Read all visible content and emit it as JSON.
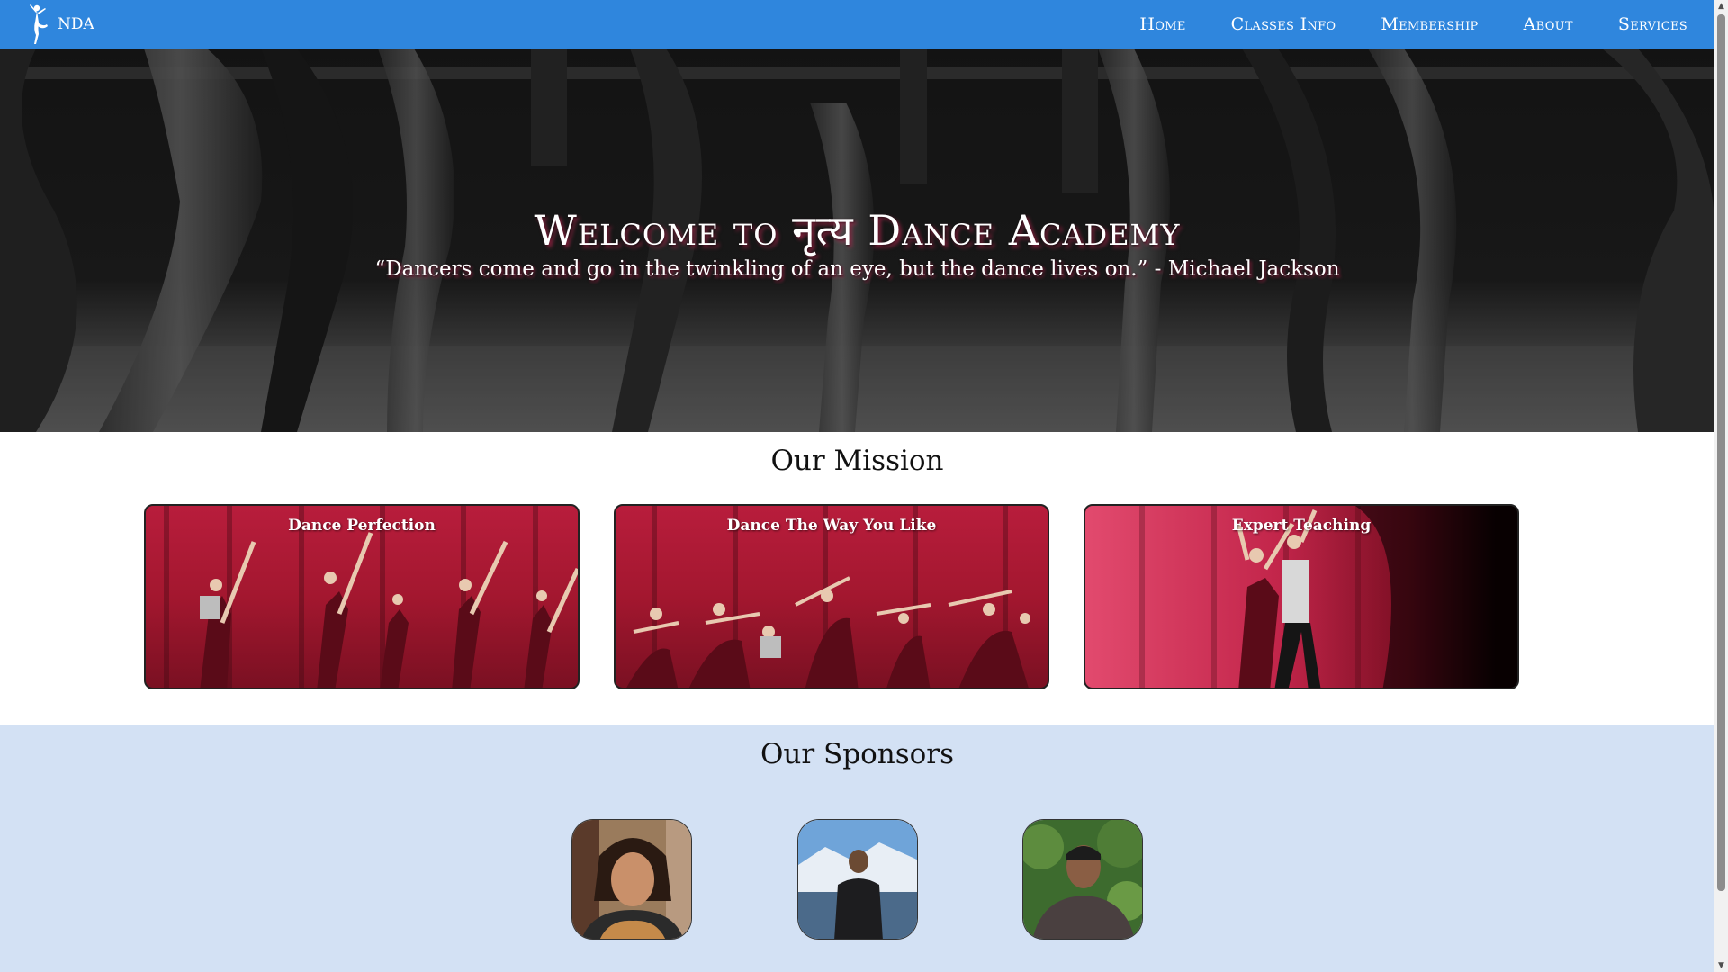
{
  "nav": {
    "brand": "NDA",
    "links": [
      "Home",
      "Classes Info",
      "Membership",
      "About",
      "Services"
    ]
  },
  "hero": {
    "title": "Welcome to नृत्य Dance Academy",
    "quote": "“Dancers come and go in the twinkling of an eye, but the dance lives on.” - Michael Jackson"
  },
  "mission": {
    "title": "Our Mission",
    "cards": [
      "Dance Perfection",
      "Dance The Way You Like",
      "Expert Teaching"
    ]
  },
  "sponsors": {
    "title": "Our Sponsors"
  },
  "colors": {
    "navbar": "#2f86dd",
    "sponsors_bg": "#d3e1f4",
    "card_red": "#b81d3c"
  },
  "scrollbar": {
    "up": "▲",
    "down": "▼"
  }
}
